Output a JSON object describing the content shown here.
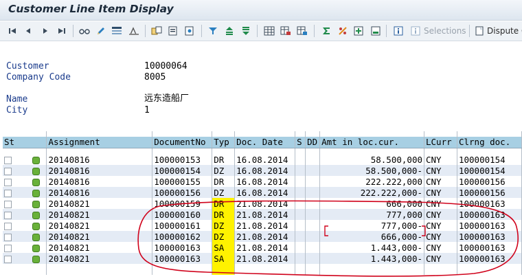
{
  "window": {
    "title": "Customer Line Item Display"
  },
  "toolbar": {
    "selections_label": "Selections",
    "dispute_label": "Dispute C"
  },
  "header": {
    "customer_label": "Customer",
    "customer_value": "10000064",
    "company_code_label": "Company Code",
    "company_code_value": "8005",
    "name_label": "Name",
    "name_value": "远东造船厂",
    "city_label": "City",
    "city_value": "1"
  },
  "grid": {
    "columns": [
      "St",
      "Assignment",
      "DocumentNo",
      "Typ",
      "Doc. Date",
      "S",
      "DD",
      "Amt in loc.cur.",
      "LCurr",
      "Clrng doc."
    ],
    "rows": [
      {
        "assignment": "20140816",
        "doc_no": "100000153",
        "type": "DR",
        "doc_date": "16.08.2014",
        "s": "",
        "dd": "",
        "amount": "58.500,000",
        "currency": "CNY",
        "clearing_doc": "100000154",
        "status": "green"
      },
      {
        "assignment": "20140816",
        "doc_no": "100000154",
        "type": "DZ",
        "doc_date": "16.08.2014",
        "s": "",
        "dd": "",
        "amount": "58.500,000-",
        "currency": "CNY",
        "clearing_doc": "100000154",
        "status": "green"
      },
      {
        "assignment": "20140816",
        "doc_no": "100000155",
        "type": "DR",
        "doc_date": "16.08.2014",
        "s": "",
        "dd": "",
        "amount": "222.222,000",
        "currency": "CNY",
        "clearing_doc": "100000156",
        "status": "green"
      },
      {
        "assignment": "20140816",
        "doc_no": "100000156",
        "type": "DZ",
        "doc_date": "16.08.2014",
        "s": "",
        "dd": "",
        "amount": "222.222,000-",
        "currency": "CNY",
        "clearing_doc": "100000156",
        "status": "green"
      },
      {
        "assignment": "20140821",
        "doc_no": "100000159",
        "type": "DR",
        "doc_date": "21.08.2014",
        "s": "",
        "dd": "",
        "amount": "666,000",
        "currency": "CNY",
        "clearing_doc": "100000163",
        "status": "green"
      },
      {
        "assignment": "20140821",
        "doc_no": "100000160",
        "type": "DR",
        "doc_date": "21.08.2014",
        "s": "",
        "dd": "",
        "amount": "777,000",
        "currency": "CNY",
        "clearing_doc": "100000163",
        "status": "green"
      },
      {
        "assignment": "20140821",
        "doc_no": "100000161",
        "type": "DZ",
        "doc_date": "21.08.2014",
        "s": "",
        "dd": "",
        "amount": "777,000-",
        "currency": "CNY",
        "clearing_doc": "100000163",
        "status": "green"
      },
      {
        "assignment": "20140821",
        "doc_no": "100000162",
        "type": "DZ",
        "doc_date": "21.08.2014",
        "s": "",
        "dd": "",
        "amount": "666,000-",
        "currency": "CNY",
        "clearing_doc": "100000163",
        "status": "green"
      },
      {
        "assignment": "20140821",
        "doc_no": "100000163",
        "type": "SA",
        "doc_date": "21.08.2014",
        "s": "",
        "dd": "",
        "amount": "1.443,000-",
        "currency": "CNY",
        "clearing_doc": "100000163",
        "status": "green"
      },
      {
        "assignment": "20140821",
        "doc_no": "100000163",
        "type": "SA",
        "doc_date": "21.08.2014",
        "s": "",
        "dd": "",
        "amount": "1.443,000-",
        "currency": "CNY",
        "clearing_doc": "100000163",
        "status": "green"
      }
    ]
  },
  "colors": {
    "header_bg": "#a7cfe3",
    "row_alt": "#e4ebf5",
    "highlight": "#fff200",
    "annotation": "#d0021b"
  }
}
